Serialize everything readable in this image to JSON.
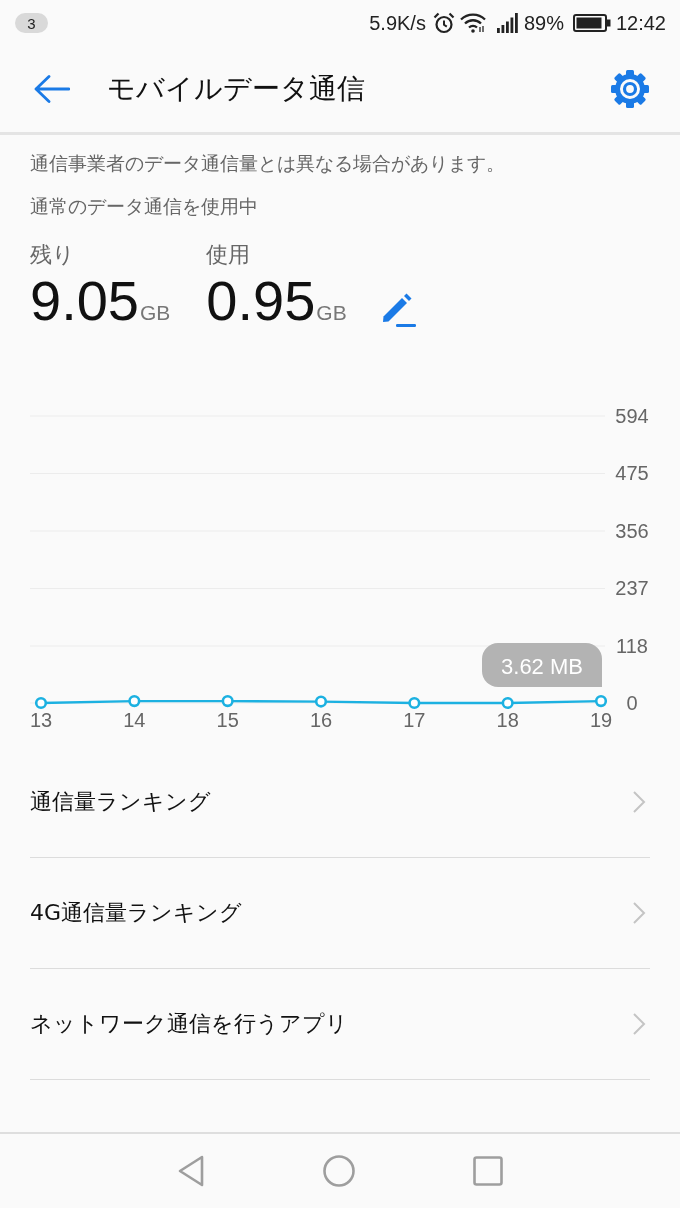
{
  "status_bar": {
    "notification_count": "3",
    "speed": "5.9K/s",
    "battery": "89%",
    "time": "12:42"
  },
  "app_bar": {
    "title": "モバイルデータ通信"
  },
  "notes": [
    "通信事業者のデータ通信量とは異なる場合があります。",
    "通常のデータ通信を使用中"
  ],
  "stats": [
    {
      "label": "残り",
      "value": "9.05",
      "unit": "GB"
    },
    {
      "label": "使用",
      "value": "0.95",
      "unit": "GB"
    }
  ],
  "chart": {
    "chart_data": {
      "type": "line",
      "categories": [
        "13",
        "14",
        "15",
        "16",
        "17",
        "18",
        "19"
      ],
      "series": [
        {
          "color": "#1cb1e1",
          "marker": "circle",
          "values": [
            0,
            4,
            4,
            3,
            0,
            0,
            4
          ]
        }
      ],
      "ylim": [
        0,
        594
      ],
      "yticks": [
        0,
        118,
        237,
        356,
        475,
        594
      ],
      "grid": true,
      "annotations": [
        "3.62 MB"
      ]
    }
  },
  "menu": [
    {
      "label": "通信量ランキング"
    },
    {
      "label": "4G通信量ランキング"
    },
    {
      "label": "ネットワーク通信を行うアプリ"
    }
  ]
}
